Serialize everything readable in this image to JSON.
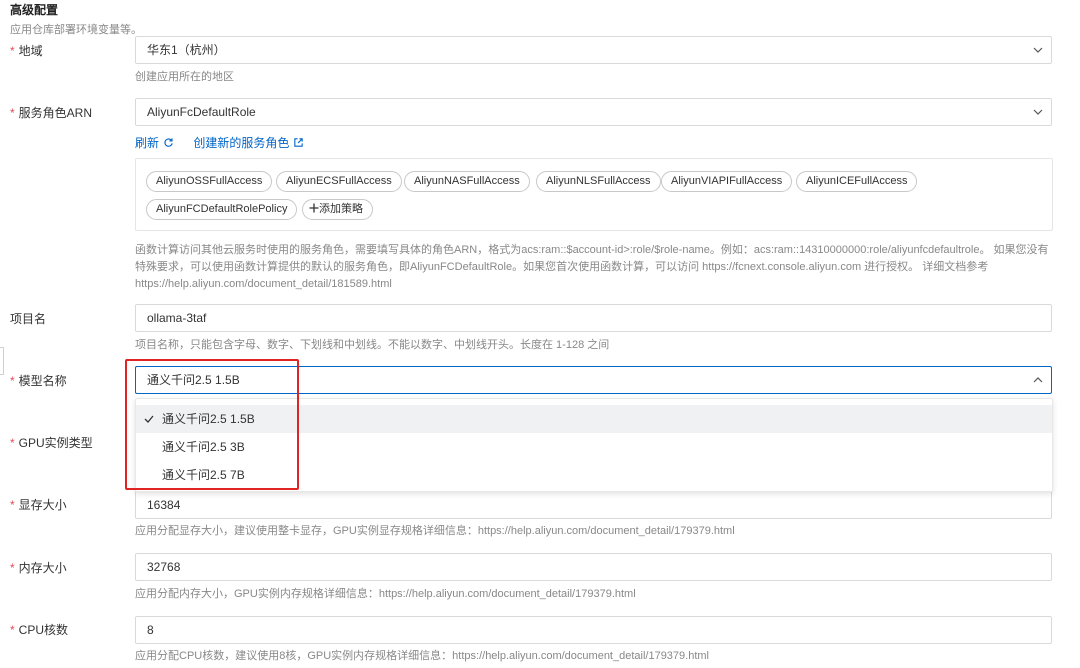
{
  "section": {
    "title": "高级配置",
    "description": "应用仓库部署环境变量等。"
  },
  "region": {
    "label": "地域",
    "value": "华东1（杭州）",
    "help": "创建应用所在的地区"
  },
  "role": {
    "label": "服务角色ARN",
    "value": "AliyunFcDefaultRole",
    "refresh_label": "刷新",
    "create_label": "创建新的服务角色",
    "policies": [
      "AliyunOSSFullAccess",
      "AliyunECSFullAccess",
      "AliyunNASFullAccess",
      "AliyunNLSFullAccess",
      "AliyunVIAPIFullAccess",
      "AliyunICEFullAccess",
      "AliyunFCDefaultRolePolicy"
    ],
    "add_policy_label": "添加策略",
    "help_line1": "函数计算访问其他云服务时使用的服务角色，需要填写具体的角色ARN，格式为acs:ram::$account-id>:role/$role-name。例如：acs:ram::14310000000:role/aliyunfcdefaultrole。 如果您没有",
    "help_line2": "特殊要求，可以使用函数计算提供的默认的服务角色，即AliyunFCDefaultRole。如果您首次使用函数计算，可以访问 https://fcnext.console.aliyun.com 进行授权。 详细文档参考",
    "help_line3": "https://help.aliyun.com/document_detail/181589.html"
  },
  "project": {
    "label": "项目名",
    "value": "ollama-3taf",
    "help": "项目名称，只能包含字母、数字、下划线和中划线。不能以数字、中划线开头。长度在 1-128 之间"
  },
  "model": {
    "label": "模型名称",
    "value": "通义千问2.5 1.5B",
    "options": [
      "通义千问2.5 1.5B",
      "通义千问2.5 3B",
      "通义千问2.5 7B"
    ]
  },
  "gpu_type": {
    "label": "GPU实例类型"
  },
  "gpu_mem": {
    "label": "显存大小",
    "value": "16384",
    "help": "应用分配显存大小，建议使用整卡显存，GPU实例显存规格详细信息：https://help.aliyun.com/document_detail/179379.html"
  },
  "memory": {
    "label": "内存大小",
    "value": "32768",
    "help": "应用分配内存大小，GPU实例内存规格详细信息：https://help.aliyun.com/document_detail/179379.html"
  },
  "cpu": {
    "label": "CPU核数",
    "value": "8",
    "help": "应用分配CPU核数，建议使用8核，GPU实例内存规格详细信息：https://help.aliyun.com/document_detail/179379.html"
  },
  "required_mark": "*",
  "colors": {
    "link": "#0064c8",
    "required": "#e34d59",
    "highlight": "#e02424",
    "focus": "#0064c8"
  },
  "icons": {
    "select": "chevron-down-icon",
    "open_select": "chevron-up-icon",
    "refresh": "refresh-icon",
    "external": "external-link-icon",
    "check": "check-icon",
    "add": "plus-icon"
  }
}
